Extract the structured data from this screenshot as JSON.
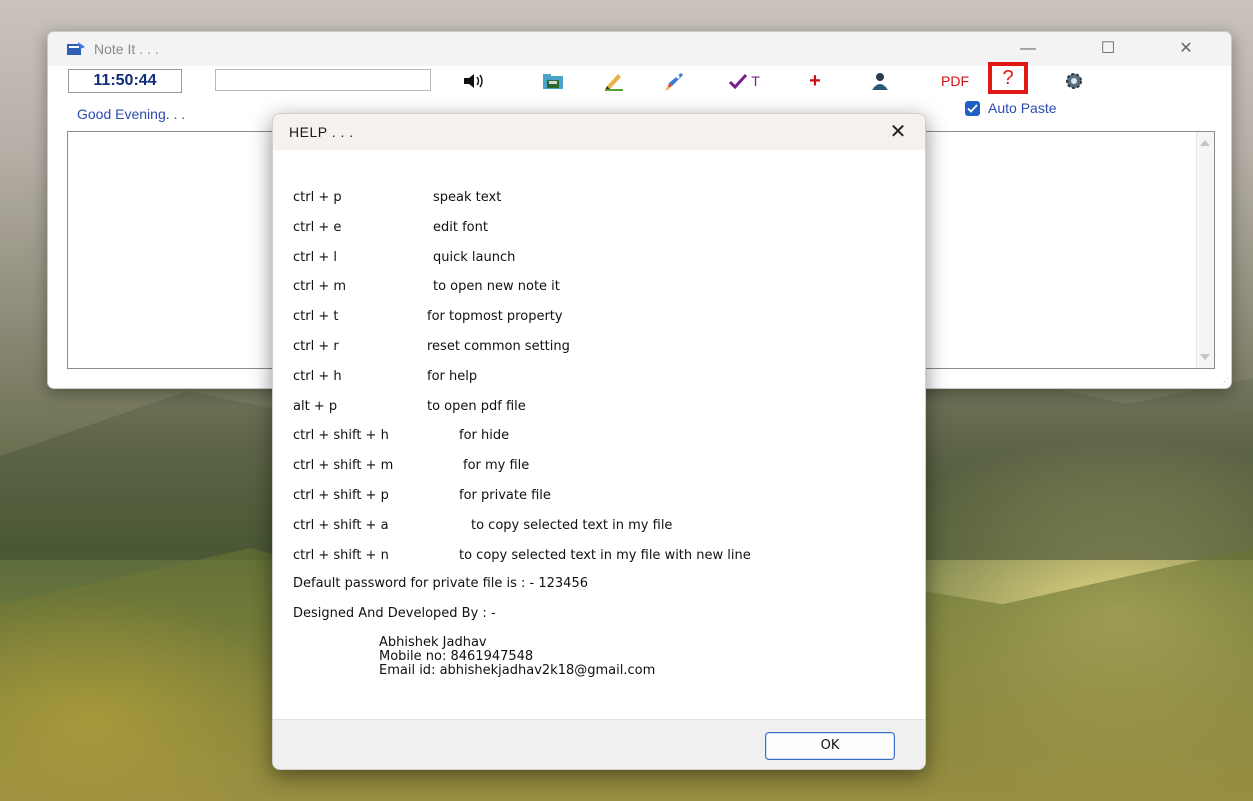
{
  "main_window": {
    "title": "Note It . . .",
    "clock": "11:50:44",
    "note_title_value": "",
    "greeting": "Good Evening. . .",
    "auto_paste_label": "Auto Paste",
    "auto_paste_checked": true,
    "toolbar": {
      "speaker_icon": "speaker-icon",
      "save_icon": "save-folder-icon",
      "edit_font_icon": "pencil-icon",
      "quick_launch_icon": "rocket-icon",
      "topmost_label": "T",
      "add_label": "+",
      "user_icon": "user-icon",
      "pdf_label": "PDF",
      "help_label": "?",
      "settings_icon": "gear-icon"
    },
    "colors": {
      "clock_text": "#0e2c7a",
      "greeting_text": "#2c4bb0",
      "pdf_text": "#d01010",
      "help_highlight": "#e01818",
      "checkbox": "#1f5fc6"
    }
  },
  "help_dialog": {
    "title": "HELP . . .",
    "close_glyph": "✕",
    "shortcuts": [
      {
        "keys": "ctrl + p",
        "desc": "speak text"
      },
      {
        "keys": "ctrl + e",
        "desc": "edit font"
      },
      {
        "keys": "ctrl + l",
        "desc": "quick launch"
      },
      {
        "keys": "ctrl + m",
        "desc": "to open new note it"
      },
      {
        "keys": "ctrl + t",
        "desc": "for topmost property"
      },
      {
        "keys": "ctrl + r",
        "desc": "reset common setting"
      },
      {
        "keys": "ctrl + h",
        "desc": "for help"
      },
      {
        "keys": "alt  + p",
        "desc": "to open pdf file"
      },
      {
        "keys": "ctrl + shift + h",
        "desc": "for hide"
      },
      {
        "keys": "ctrl + shift + m",
        "desc": "for my file"
      },
      {
        "keys": "ctrl + shift + p",
        "desc": "for private file"
      },
      {
        "keys": "ctrl + shift + a",
        "desc": "to copy selected text in my file"
      },
      {
        "keys": "ctrl + shift + n",
        "desc": "to copy selected text in my file with new line"
      }
    ],
    "password_line": "Default password for private file is : - 123456",
    "designed_by_label": "Designed And Developed By : -",
    "developer_name": "Abhishek Jadhav",
    "developer_mobile": "Mobile no: 8461947548",
    "developer_email": "Email id: abhishekjadhav2k18@gmail.com",
    "ok_label": "OK"
  }
}
